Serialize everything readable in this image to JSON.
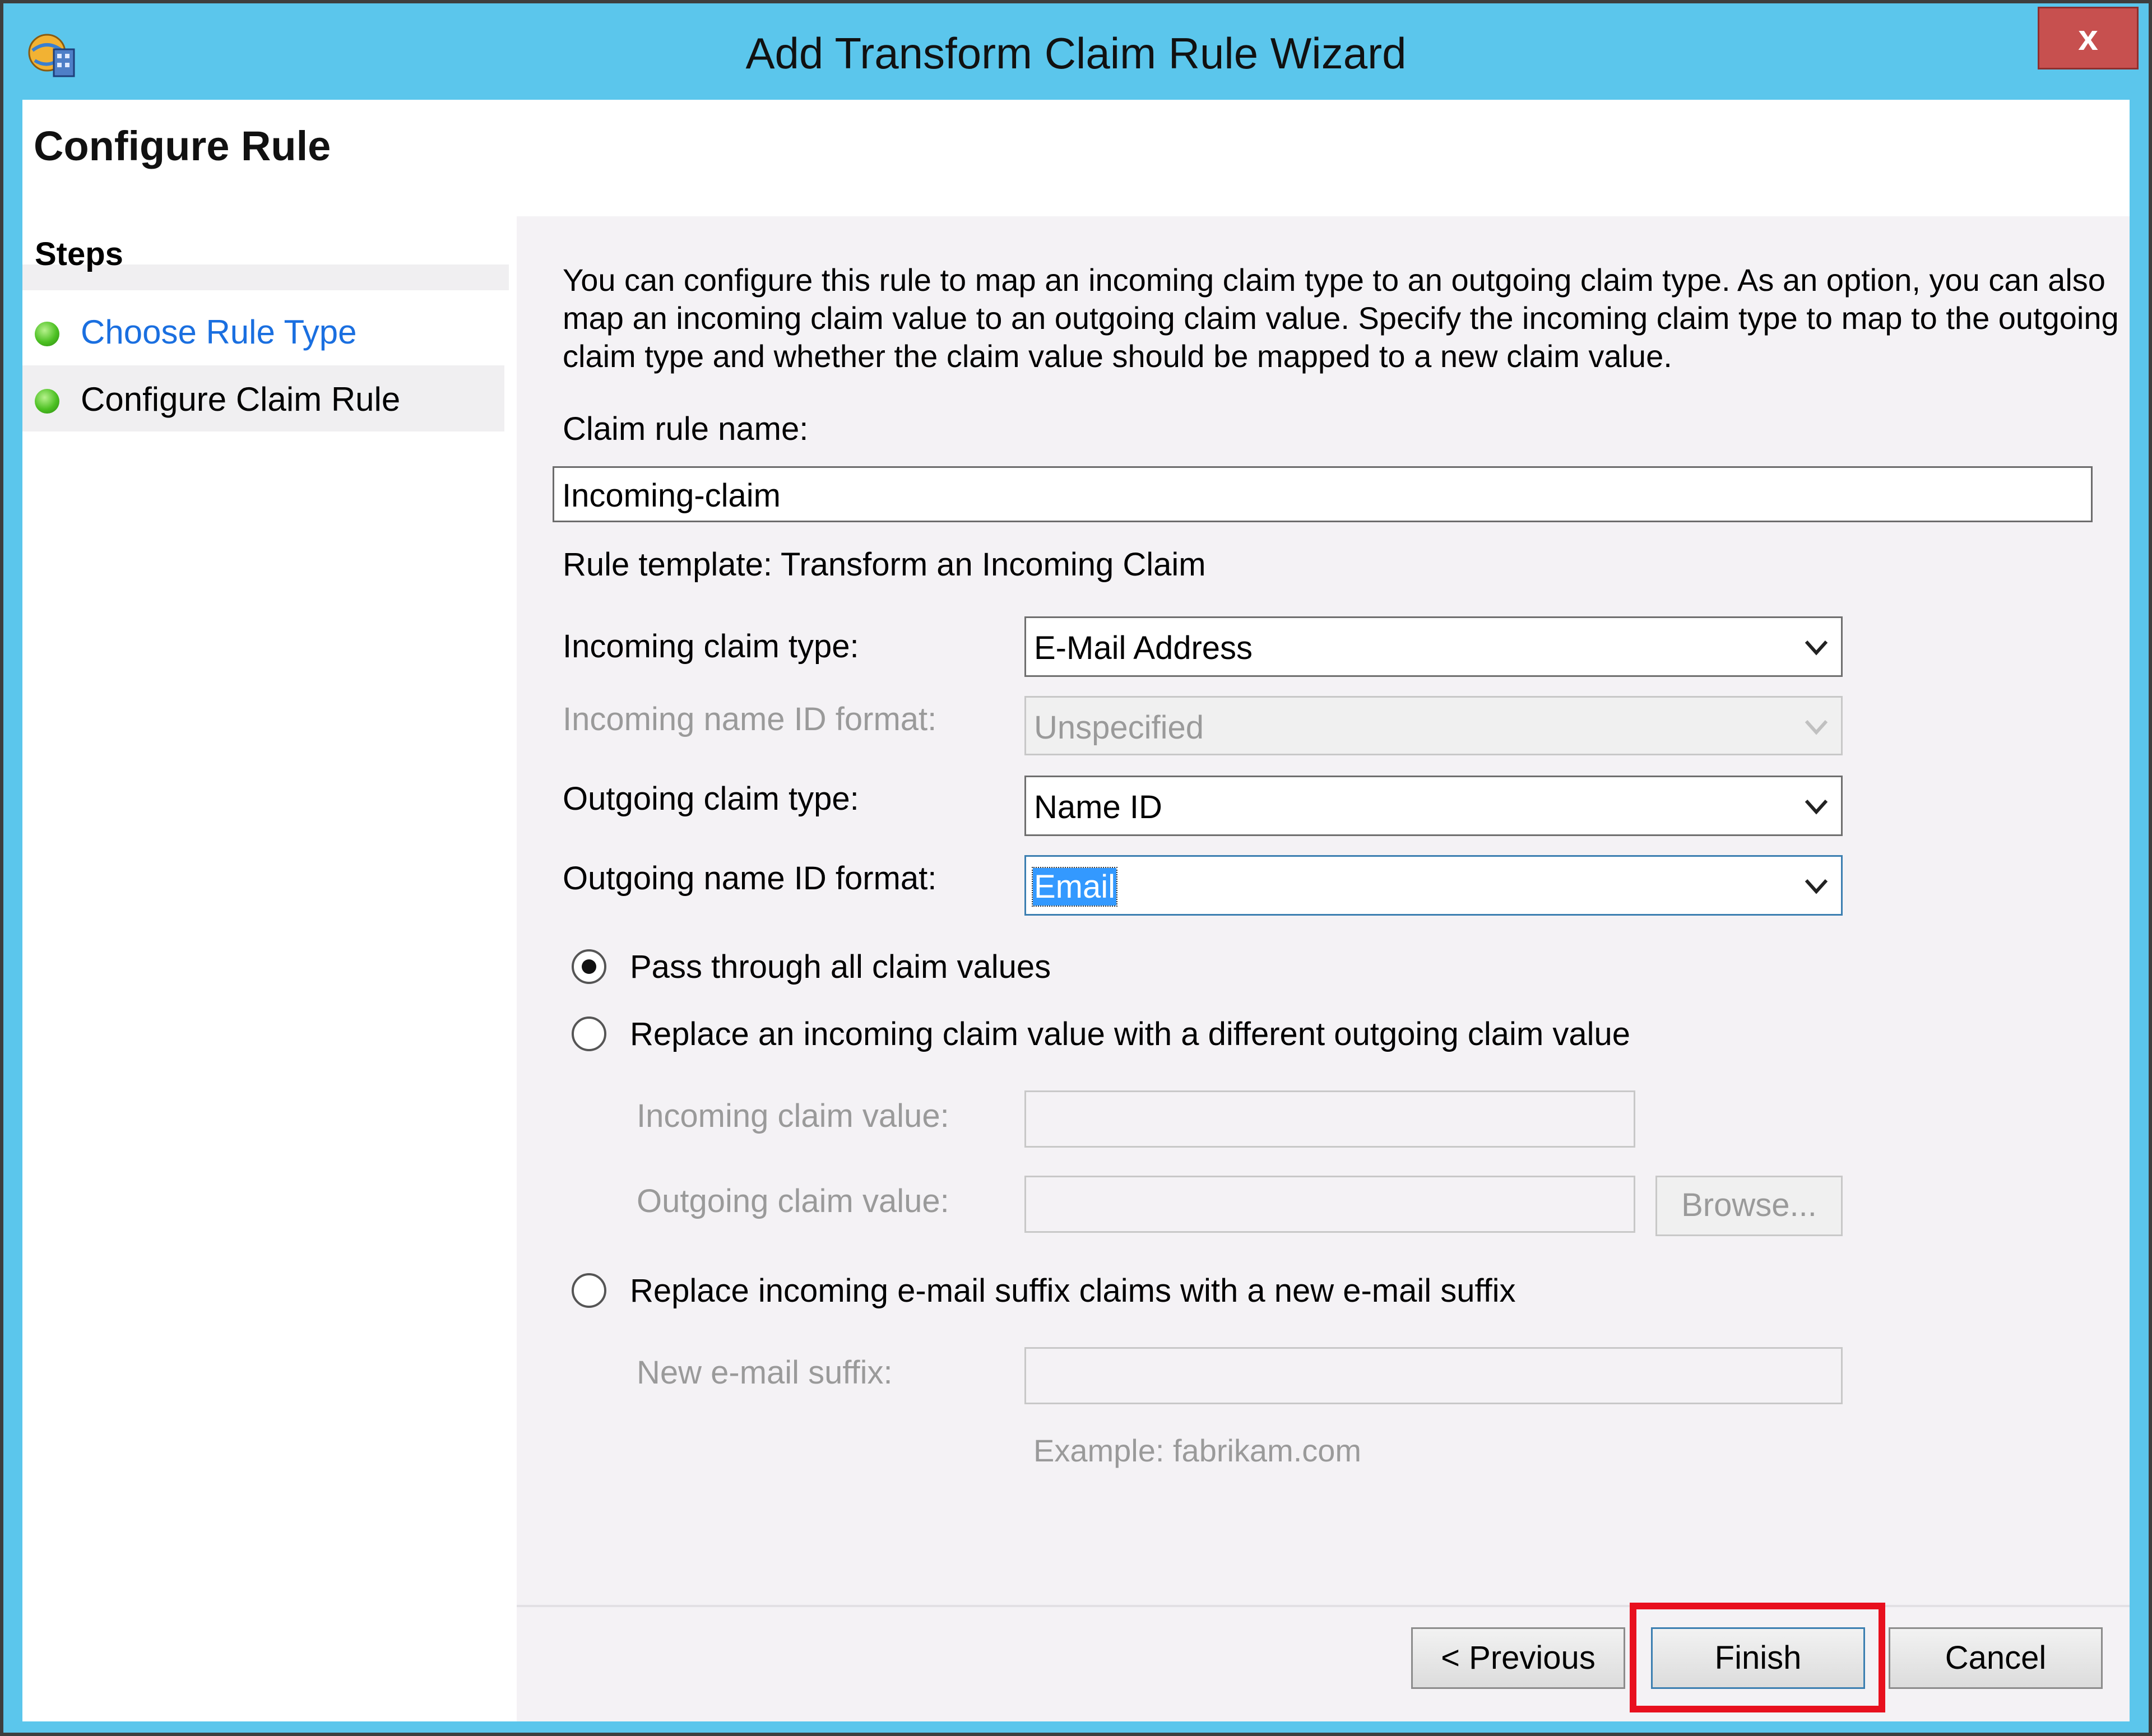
{
  "window": {
    "title": "Add Transform Claim Rule Wizard",
    "close_label": "x"
  },
  "header": {
    "title": "Configure Rule"
  },
  "steps": {
    "heading": "Steps",
    "items": [
      {
        "label": "Choose Rule Type"
      },
      {
        "label": "Configure Claim Rule"
      }
    ]
  },
  "content": {
    "intro": "You can configure this rule to map an incoming claim type to an outgoing claim type. As an option, you can also map an incoming claim value to an outgoing claim value. Specify the incoming claim type to map to the outgoing claim type and whether the claim value should be mapped to a new claim value.",
    "rule_name_label": "Claim rule name:",
    "rule_name_value": "Incoming-claim",
    "rule_template": "Rule template: Transform an Incoming Claim",
    "incoming_claim_type_label": "Incoming claim type:",
    "incoming_claim_type_value": "E-Mail Address",
    "incoming_name_id_label": "Incoming name ID format:",
    "incoming_name_id_value": "Unspecified",
    "outgoing_claim_type_label": "Outgoing claim type:",
    "outgoing_claim_type_value": "Name ID",
    "outgoing_name_id_label": "Outgoing name ID format:",
    "outgoing_name_id_value": "Email",
    "radio_pass_through": "Pass through all claim values",
    "radio_replace_value": "Replace an incoming claim value with a different outgoing claim value",
    "incoming_value_label": "Incoming claim value:",
    "outgoing_value_label": "Outgoing claim value:",
    "browse_label": "Browse...",
    "radio_replace_suffix": "Replace incoming e-mail suffix claims with a new e-mail suffix",
    "new_suffix_label": "New e-mail suffix:",
    "suffix_example": "Example: fabrikam.com",
    "selected_option": "pass_through"
  },
  "footer": {
    "previous_label": "< Previous",
    "finish_label": "Finish",
    "cancel_label": "Cancel"
  },
  "colors": {
    "titlebar": "#5bc6ec",
    "close_button": "#c7504f",
    "link": "#1a6fe0",
    "selection": "#3399ff",
    "highlight_box": "#e8101e"
  }
}
